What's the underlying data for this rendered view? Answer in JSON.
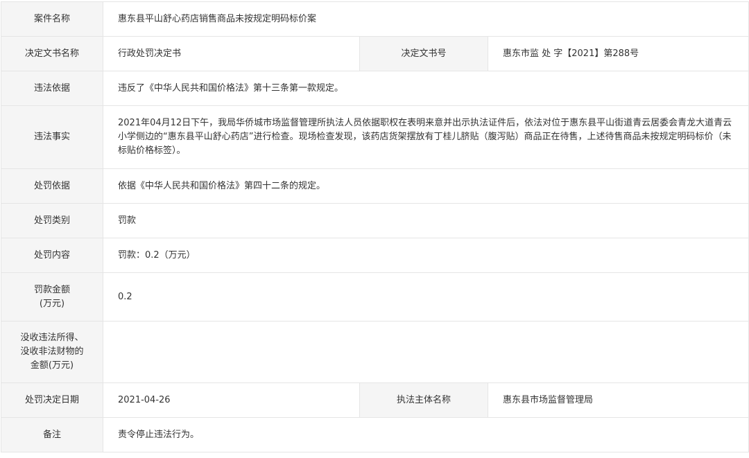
{
  "rows": {
    "case_name": {
      "label": "案件名称",
      "value": "惠东县平山舒心药店销售商品未按规定明码标价案"
    },
    "decision_doc_name": {
      "label": "决定文书名称",
      "value": "行政处罚决定书"
    },
    "decision_doc_no": {
      "label": "决定文书号",
      "value": "惠东市监 处 字【2021】第288号"
    },
    "legal_basis": {
      "label": "违法依据",
      "value": "违反了《中华人民共和国价格法》第十三条第一款规定。"
    },
    "illegal_facts": {
      "label": "违法事实",
      "value": "2021年04月12日下午，我局华侨城市场监督管理所执法人员依据职权在表明来意并出示执法证件后，依法对位于惠东县平山街道青云居委会青龙大道青云小学侧边的“惠东县平山舒心药店”进行检查。现场检查发现，该药店货架摆放有丁桂儿脐贴（腹泻贴）商品正在待售，上述待售商品未按规定明码标价（未标贴价格标签）。"
    },
    "penalty_basis": {
      "label": "处罚依据",
      "value": "依据《中华人民共和国价格法》第四十二条的规定。"
    },
    "penalty_type": {
      "label": "处罚类别",
      "value": "罚款"
    },
    "penalty_content": {
      "label": "处罚内容",
      "value": "罚款：0.2（万元）"
    },
    "fine_amount": {
      "label_line1": "罚款金额",
      "label_line2": "(万元)",
      "value": "0.2"
    },
    "confiscation": {
      "label_line1": "没收违法所得、",
      "label_line2": "没收非法财物的",
      "label_line3": "金额(万元)",
      "value": ""
    },
    "decision_date": {
      "label": "处罚决定日期",
      "value": "2021-04-26"
    },
    "enforcement_body": {
      "label": "执法主体名称",
      "value": "惠东县市场监督管理局"
    },
    "remarks": {
      "label": "备注",
      "value": "责令停止违法行为。"
    }
  }
}
